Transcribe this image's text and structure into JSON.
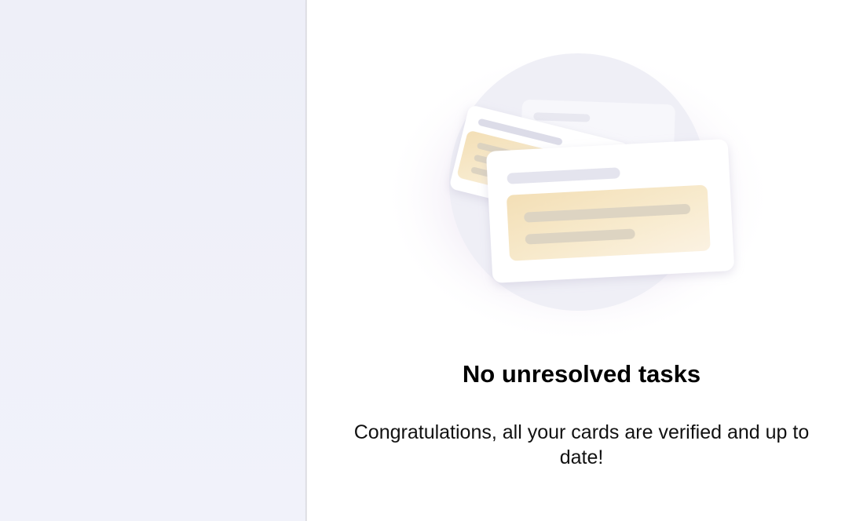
{
  "empty_state": {
    "title": "No unresolved tasks",
    "message": "Congratulations, all your cards are verified and up to date!",
    "illustration_icon": "stacked-cards-icon"
  },
  "colors": {
    "sidebar_bg": "#eff0f8",
    "main_bg": "#ffffff",
    "circle_bg": "#efeff6",
    "card_bg": "#ffffff",
    "card_highlight": "#f6e6c6",
    "placeholder_line": "#e3e3ee",
    "title_text": "#000000",
    "message_text": "#111111"
  }
}
